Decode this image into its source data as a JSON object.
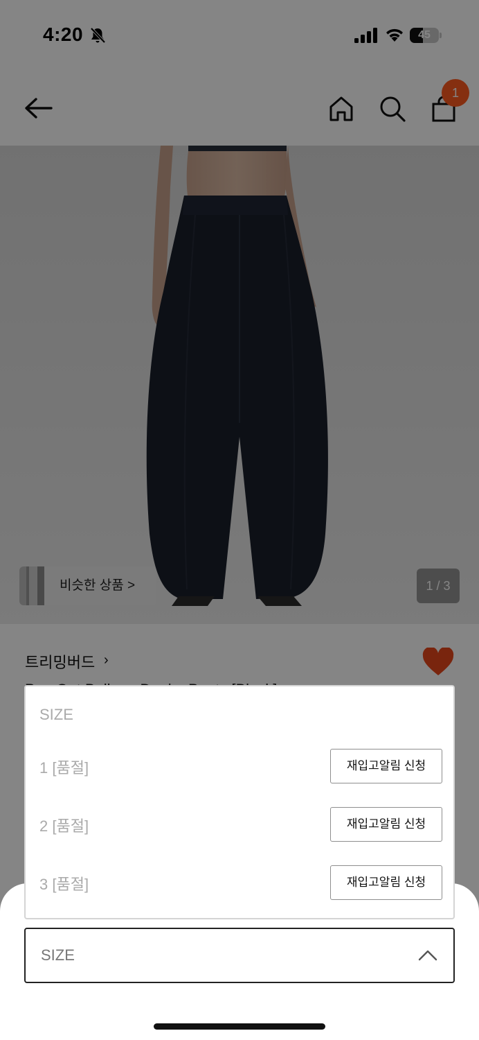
{
  "status_bar": {
    "time": "4:20",
    "battery_level": "45",
    "battery_fraction": 0.45
  },
  "header": {
    "cart_count": "1",
    "icons": [
      "back-arrow-icon",
      "home-icon",
      "search-icon",
      "shopping-bag-icon"
    ]
  },
  "product": {
    "image_page": "1 / 3",
    "similar_label": "비슷한 상품 >",
    "brand": "트리밍버드",
    "name": "Pen Out Balloon Denim Pants [Black]",
    "liked": true
  },
  "size_dropdown": {
    "header": "SIZE",
    "options": [
      {
        "label": "1 [품절]",
        "action": "재입고알림 신청"
      },
      {
        "label": "2 [품절]",
        "action": "재입고알림 신청"
      },
      {
        "label": "3 [품절]",
        "action": "재입고알림 신청"
      }
    ]
  },
  "size_select": {
    "placeholder": "SIZE"
  },
  "colors": {
    "badge": "#ff5a1f",
    "heart": "#e8481c",
    "text_disabled": "#aaaaaa"
  }
}
